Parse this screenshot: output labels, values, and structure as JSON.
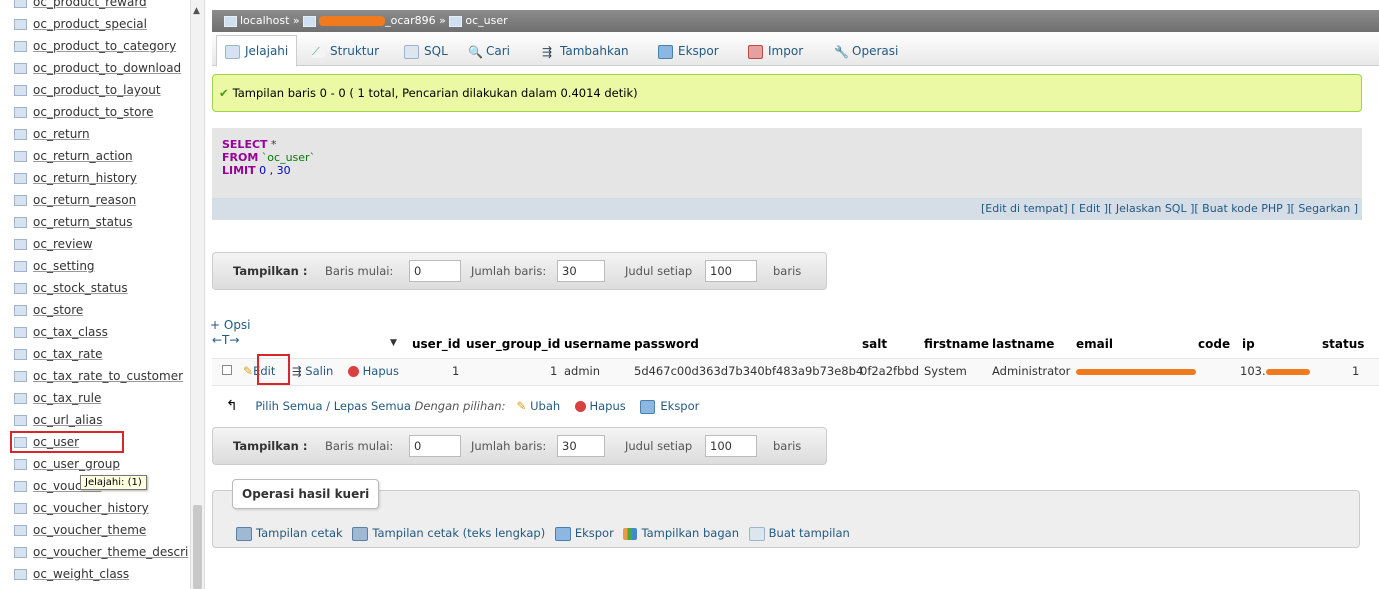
{
  "sidebar": {
    "items": [
      {
        "label": "oc_product_reward"
      },
      {
        "label": "oc_product_special"
      },
      {
        "label": "oc_product_to_category"
      },
      {
        "label": "oc_product_to_download"
      },
      {
        "label": "oc_product_to_layout"
      },
      {
        "label": "oc_product_to_store"
      },
      {
        "label": "oc_return"
      },
      {
        "label": "oc_return_action"
      },
      {
        "label": "oc_return_history"
      },
      {
        "label": "oc_return_reason"
      },
      {
        "label": "oc_return_status"
      },
      {
        "label": "oc_review"
      },
      {
        "label": "oc_setting"
      },
      {
        "label": "oc_stock_status"
      },
      {
        "label": "oc_store"
      },
      {
        "label": "oc_tax_class"
      },
      {
        "label": "oc_tax_rate"
      },
      {
        "label": "oc_tax_rate_to_customer"
      },
      {
        "label": "oc_tax_rule"
      },
      {
        "label": "oc_url_alias"
      },
      {
        "label": "oc_user"
      },
      {
        "label": "oc_user_group"
      },
      {
        "label": "oc_voucher"
      },
      {
        "label": "oc_voucher_history"
      },
      {
        "label": "oc_voucher_theme"
      },
      {
        "label": "oc_voucher_theme_descri"
      },
      {
        "label": "oc_weight_class"
      }
    ],
    "active_item": "oc_user",
    "tooltip": "Jelajahi: (1)"
  },
  "breadcrumb": {
    "server": "localhost",
    "database_suffix": "_ocar896",
    "table": "oc_user",
    "separator": "»"
  },
  "tabs": [
    {
      "label": "Jelajahi",
      "icon": "browse-icon",
      "active": true
    },
    {
      "label": "Struktur",
      "icon": "structure-icon"
    },
    {
      "label": "SQL",
      "icon": "sql-icon"
    },
    {
      "label": "Cari",
      "icon": "search-icon"
    },
    {
      "label": "Tambahkan",
      "icon": "insert-icon"
    },
    {
      "label": "Ekspor",
      "icon": "export-icon"
    },
    {
      "label": "Impor",
      "icon": "import-icon"
    },
    {
      "label": "Operasi",
      "icon": "wrench-icon"
    }
  ],
  "notice": {
    "text": "Tampilan baris 0 - 0 ( 1 total, Pencarian dilakukan dalam 0.4014 detik)"
  },
  "sql": {
    "select_kw": "SELECT",
    "select_rest": " *",
    "from_kw": "FROM",
    "from_rest": " `oc_user`",
    "limit_kw": "LIMIT",
    "limit_rest": " 0 , 30",
    "links": [
      "[Edit di tempat]",
      "[ Edit ]",
      "[ Jelaskan SQL ]",
      "[ Buat kode PHP ]",
      "[ Segarkan ]"
    ]
  },
  "navigation": {
    "label": "Tampilkan :",
    "start_label": "Baris mulai:",
    "start_value": "0",
    "count_label": "Jumlah baris:",
    "count_value": "30",
    "header_label": "Judul setiap",
    "header_value": "100",
    "rows_suffix": "baris"
  },
  "results": {
    "options_link": "+ Opsi",
    "sort_arrows": "←T→",
    "columns": [
      "user_id",
      "user_group_id",
      "username",
      "password",
      "salt",
      "firstname",
      "lastname",
      "email",
      "code",
      "ip",
      "status"
    ],
    "row": {
      "actions": {
        "edit": "Edit",
        "copy": "Salin",
        "delete": "Hapus"
      },
      "user_id": "1",
      "user_group_id": "1",
      "username": "admin",
      "password": "5d467c00d363d7b340bf483a9b73e8b4",
      "salt": "0f2a2fbbd",
      "firstname": "System",
      "lastname": "Administrator",
      "email": "",
      "code": "",
      "ip": "103.",
      "status": "1"
    }
  },
  "bulk": {
    "select_all": "Pilih Semua / Lepas Semua",
    "with_selected": "Dengan pilihan:",
    "change": "Ubah",
    "delete": "Hapus",
    "export": "Ekspor"
  },
  "query_ops": {
    "legend": "Operasi hasil kueri",
    "links": [
      {
        "label": "Tampilan cetak",
        "icon": "print-icon"
      },
      {
        "label": "Tampilan cetak (teks lengkap)",
        "icon": "print-icon"
      },
      {
        "label": "Ekspor",
        "icon": "export-icon"
      },
      {
        "label": "Tampilkan bagan",
        "icon": "chart-icon"
      },
      {
        "label": "Buat tampilan",
        "icon": "view-icon"
      }
    ]
  },
  "colors": {
    "link": "#235a81",
    "highlight_red": "#d9262c",
    "notice_bg": "#ebf8a4",
    "redaction": "#f07a1e"
  }
}
